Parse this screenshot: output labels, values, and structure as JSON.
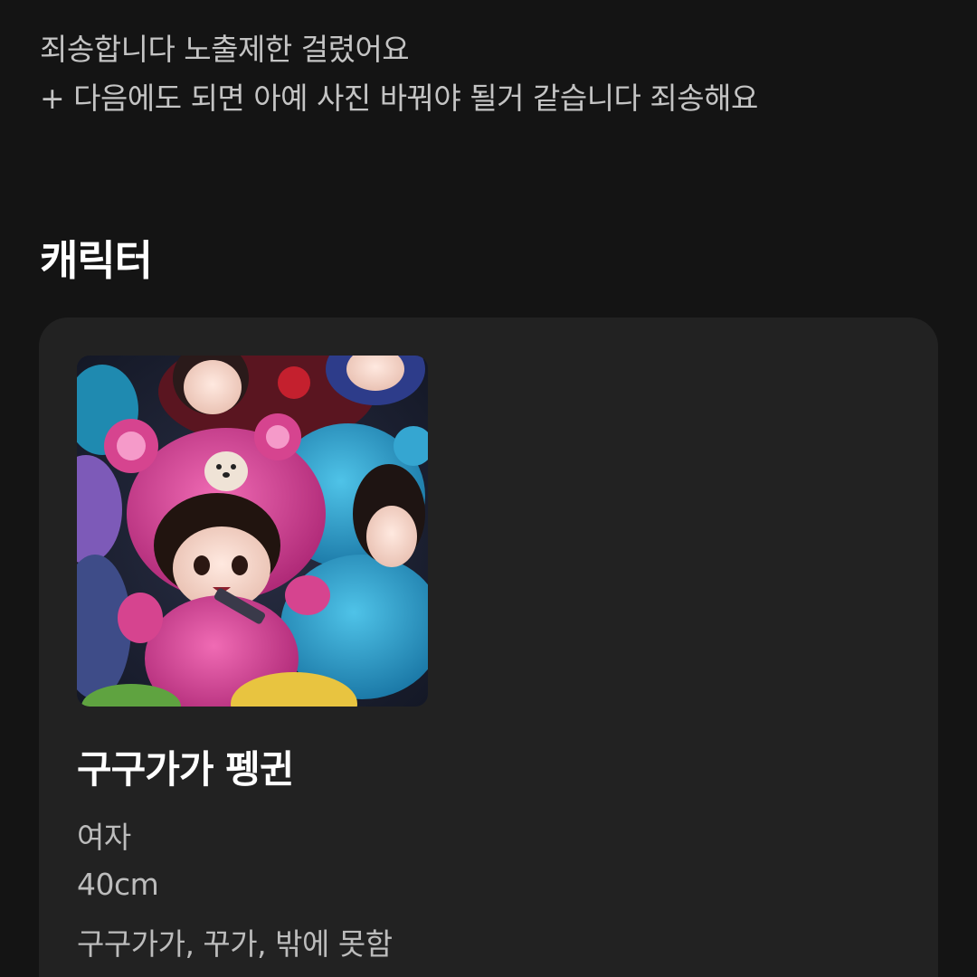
{
  "notice": {
    "line1": "죄송합니다 노출제한 걸렸어요",
    "line2": "+ 다음에도 되면 아예 사진 바꿔야 될거 같습니다 죄송해요"
  },
  "section": {
    "title": "캐릭터"
  },
  "character": {
    "name": "구구가가 펭귄",
    "gender": "여자",
    "size": "40cm",
    "speech": "구구가가, 꾸가, 밖에 못함"
  }
}
